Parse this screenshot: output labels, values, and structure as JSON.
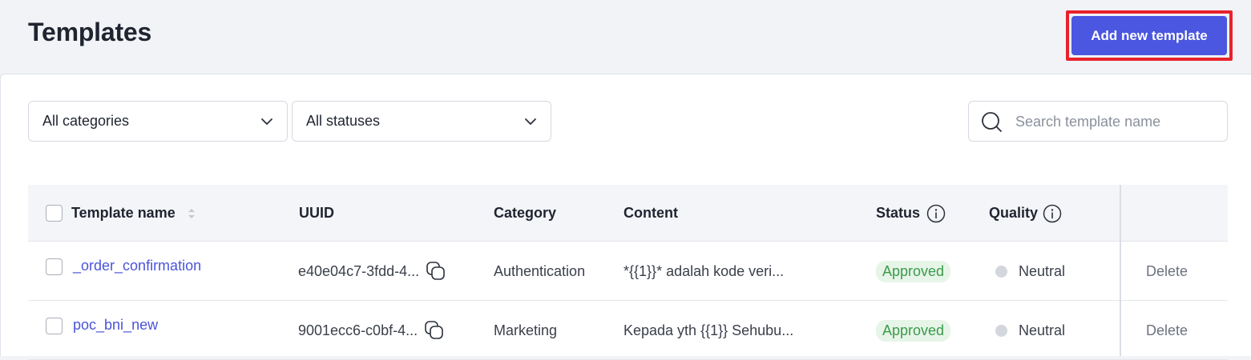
{
  "header": {
    "title": "Templates",
    "add_button_label": "Add new template",
    "accent_color": "#4b57e0",
    "highlight_color": "#e8222c"
  },
  "filters": {
    "category_selected": "All categories",
    "status_selected": "All statuses",
    "search_placeholder": "Search template name"
  },
  "table": {
    "columns": {
      "name": "Template name",
      "uuid": "UUID",
      "category": "Category",
      "content": "Content",
      "status": "Status",
      "quality": "Quality"
    },
    "rows": [
      {
        "name": "_order_confirmation",
        "uuid": "e40e04c7-3fdd-4...",
        "category": "Authentication",
        "content": "*{{1}}* adalah kode veri...",
        "status": "Approved",
        "quality": "Neutral",
        "action": "Delete"
      },
      {
        "name": "poc_bni_new",
        "uuid": "9001ecc6-c0bf-4...",
        "category": "Marketing",
        "content": "Kepada yth {{1}} Sehubu...",
        "status": "Approved",
        "quality": "Neutral",
        "action": "Delete"
      }
    ]
  }
}
